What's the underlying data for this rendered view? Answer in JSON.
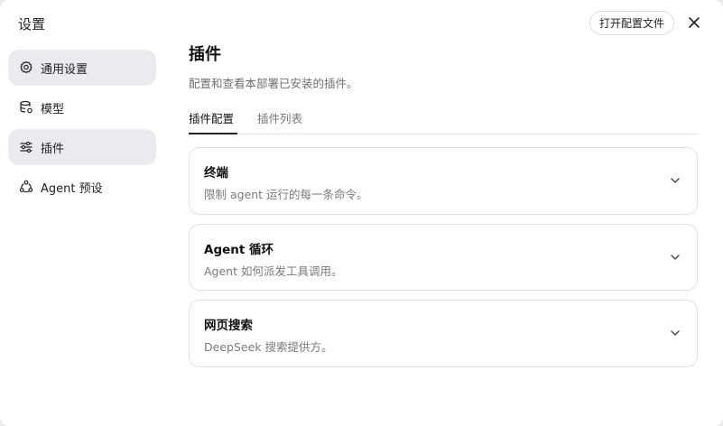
{
  "dialog": {
    "title": "设置",
    "open_config_label": "打开配置文件"
  },
  "sidebar": {
    "items": [
      {
        "label": "通用设置",
        "icon": "gear-icon",
        "active": true
      },
      {
        "label": "模型",
        "icon": "database-settings-icon",
        "active": false
      },
      {
        "label": "插件",
        "icon": "sliders-icon",
        "active": true
      },
      {
        "label": "Agent 预设",
        "icon": "agent-cycle-icon",
        "active": false
      }
    ]
  },
  "main": {
    "title": "插件",
    "subtitle": "配置和查看本部署已安装的插件。",
    "tabs": [
      {
        "label": "插件配置",
        "active": true
      },
      {
        "label": "插件列表",
        "active": false
      }
    ],
    "cards": [
      {
        "title": "终端",
        "description": "限制 agent 运行的每一条命令。"
      },
      {
        "title": "Agent 循环",
        "description": "Agent 如何派发工具调用。"
      },
      {
        "title": "网页搜索",
        "description": "DeepSeek 搜索提供方。"
      }
    ]
  }
}
